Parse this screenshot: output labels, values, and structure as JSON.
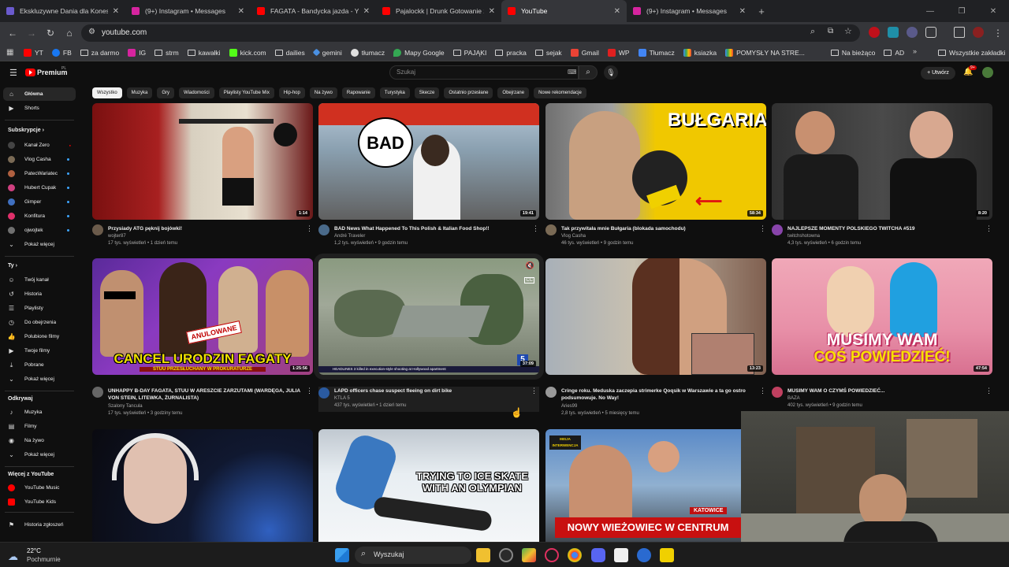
{
  "browser": {
    "tabs": [
      {
        "title": "Ekskluzywne Dania dla Konesera",
        "favicon_color": "#6a5acd"
      },
      {
        "title": "(9+) Instagram • Messages",
        "favicon_color": "#d6249f"
      },
      {
        "title": "FAGATA - Bandycka jazda - YouTube",
        "favicon_color": "#ff0000"
      },
      {
        "title": "Pajalockk | Drunk Gotowanie z A...",
        "favicon_color": "#ff0000"
      },
      {
        "title": "YouTube",
        "favicon_color": "#ff0000"
      },
      {
        "title": "(9+) Instagram • Messages",
        "favicon_color": "#d6249f"
      }
    ],
    "url": "youtube.com",
    "bookmarks": [
      {
        "label": "YT",
        "icon": "youtube"
      },
      {
        "label": "FB",
        "icon": "facebook"
      },
      {
        "label": "za darmo",
        "icon": "folder"
      },
      {
        "label": "IG",
        "icon": "instagram"
      },
      {
        "label": "strm",
        "icon": "folder"
      },
      {
        "label": "kawałki",
        "icon": "folder"
      },
      {
        "label": "kick.com",
        "icon": "kick"
      },
      {
        "label": "dailies",
        "icon": "folder"
      },
      {
        "label": "gemini",
        "icon": "gemini"
      },
      {
        "label": "tłumacz",
        "icon": "translate"
      },
      {
        "label": "Mapy Google",
        "icon": "maps"
      },
      {
        "label": "PAJĄKI",
        "icon": "folder"
      },
      {
        "label": "pracka",
        "icon": "folder"
      },
      {
        "label": "sejak",
        "icon": "folder"
      },
      {
        "label": "Gmail",
        "icon": "gmail"
      },
      {
        "label": "WP",
        "icon": "wp"
      },
      {
        "label": "Tłumacz",
        "icon": "translate"
      },
      {
        "label": "ksiazka",
        "icon": "google"
      },
      {
        "label": "POMYSŁY NA STRE...",
        "icon": "google"
      },
      {
        "label": "Na bieżąco",
        "icon": "folder"
      },
      {
        "label": "AD",
        "icon": "folder"
      }
    ],
    "all_bookmarks": "Wszystkie zakładki"
  },
  "youtube": {
    "logo": "Premium",
    "logo_sup": "PL",
    "search_placeholder": "Szukaj",
    "create_label": "Utwórz",
    "notif_count": "9+",
    "chips": [
      "Wszystko",
      "Muzyka",
      "Gry",
      "Wiadomości",
      "Playlisty YouTube Mix",
      "Hip-hop",
      "Na żywo",
      "Rapowanie",
      "Turystyka",
      "Skecze",
      "Ostatnio przesłane",
      "Obejrzane",
      "Nowe rekomendacje"
    ],
    "sidebar": {
      "main": [
        "Główna",
        "Shorts"
      ],
      "subs_heading": "Subskrypcje",
      "subs": [
        {
          "name": "Kanał Zero",
          "color": "#444444"
        },
        {
          "name": "Vlog Casha",
          "color": "#7a6a55"
        },
        {
          "name": "PatecWariatec",
          "color": "#b06040"
        },
        {
          "name": "Hubert Cupak",
          "color": "#d04080"
        },
        {
          "name": "Gimper",
          "color": "#4070c0"
        },
        {
          "name": "Konfitura",
          "color": "#e0306a"
        },
        {
          "name": "ojwojtek",
          "color": "#707070"
        }
      ],
      "show_more": "Pokaż więcej",
      "you_heading": "Ty",
      "you": [
        "Twój kanał",
        "Historia",
        "Playlisty",
        "Do obejrzenia",
        "Polubione filmy",
        "Twoje filmy",
        "Pobrane",
        "Pokaż więcej"
      ],
      "explore_heading": "Odkrywaj",
      "explore": [
        "Muzyka",
        "Filmy",
        "Na żywo",
        "Pokaż więcej"
      ],
      "more_heading": "Więcej z YouTube",
      "more": [
        "YouTube Music",
        "YouTube Kids"
      ],
      "report": "Historia zgłoszeń"
    },
    "videos": [
      {
        "title": "Przysiady ATG pęknij bojówki!",
        "channel": "wojter87",
        "stats": "17 tys. wyświetleń • 1 dzień temu",
        "duration": "1:14",
        "avatar": "#6b5b4b"
      },
      {
        "title": "BAD News What Happened To This Polish & Italian Food Shop!!",
        "channel": "André Traveler",
        "stats": "1,2 tys. wyświetleń • 9 godzin temu",
        "duration": "19:41",
        "avatar": "#4a6a8a",
        "overlay": "BAD"
      },
      {
        "title": "Tak przywitała mnie Bułgaria (blokada samochodu)",
        "channel": "Vlog Casha",
        "stats": "46 tys. wyświetleń • 9 godzin temu",
        "duration": "58:34",
        "avatar": "#7a6a55",
        "overlay": "BUŁGARIA"
      },
      {
        "title": "NAJLEPSZE MOMENTY POLSKIEGO TWITCHA #519",
        "channel": "twitchshotowna",
        "stats": "4,3 tys. wyświetleń • 6 godzin temu",
        "duration": "8:20",
        "avatar": "#8844aa"
      },
      {
        "title": "UNHAPPY B-DAY FAGATA, STUU W ARESZCIE ZARZUTAMI (WARDĘGA, JULIA VON STEIN, LITEWKA, ŻURNALISTA)",
        "channel": "Szalony Tancula",
        "stats": "17 tys. wyświetleń • 3 godziny temu",
        "duration": "1:25:56",
        "avatar": "#666666",
        "overlay": "CANCEL URODZIN FAGATY",
        "overlay2": "STUU PRZESŁUCHANY W PROKURATURZE",
        "stamp": "ANULOWANE"
      },
      {
        "title": "LAPD officers chase suspect fleeing on dirt bike",
        "channel": "KTLA 5",
        "stats": "437 tys. wyświetleń • 1 dzień temu",
        "duration": "37:09",
        "avatar": "#2a5aa0",
        "ticker": "HEADLINES  3 killed in execution-style shooting at Hollywood apartment",
        "station": "5"
      },
      {
        "title": "Cringe roku. Meduska zaczepia strimerke Qoqsik w Warszawie a ta go ostro podsumowuje. No Way!",
        "channel": "Aries99",
        "stats": "2,8 tys. wyświetleń • 5 miesięcy temu",
        "duration": "13:23",
        "avatar": "#999999"
      },
      {
        "title": "MUSIMY WAM O CZYMŚ POWIEDZIEĆ...",
        "channel": "BAZA",
        "stats": "402 tys. wyświetleń • 9 godzin temu",
        "duration": "47:54",
        "avatar": "#c04060",
        "overlay": "MUSIMY WAM",
        "overlay2": "COŚ POWIEDZIEĆ!"
      },
      {
        "title": "",
        "overlay": ""
      },
      {
        "title": "",
        "overlay": "TRYING TO ICE SKATE WITH AN OLYMPIAN"
      },
      {
        "title": "",
        "overlay": "NOWY WIEŻOWIEC W CENTRUM",
        "tag": "KATOWICE",
        "badge": "MISJA INTERWENCJA"
      }
    ]
  },
  "taskbar": {
    "temp": "22°C",
    "weather": "Pochmurnie",
    "search": "Wyszukaj"
  }
}
